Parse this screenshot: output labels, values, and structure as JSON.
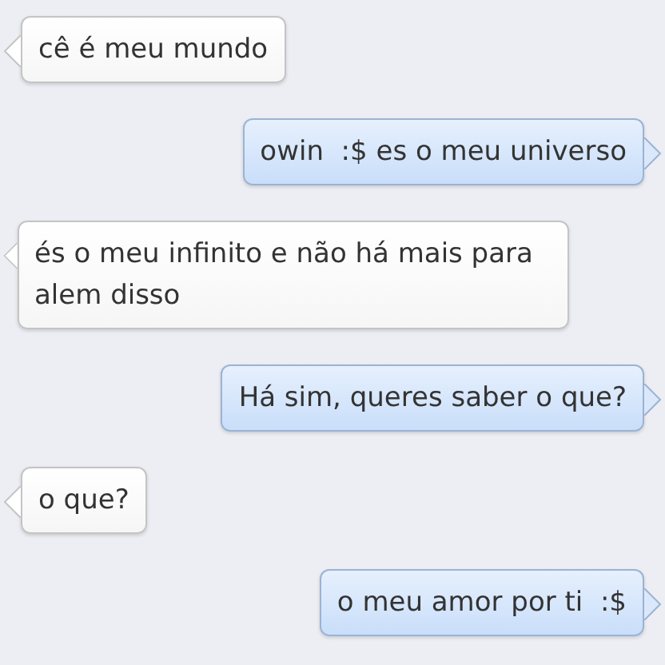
{
  "messages": [
    {
      "kind": "received",
      "text": "cê é meu mundo"
    },
    {
      "kind": "sent",
      "text": "owin  :$ es o meu universo"
    },
    {
      "kind": "received",
      "text": "és o meu infinito e não há mais para alem disso"
    },
    {
      "kind": "sent",
      "text": "Há sim, queres saber o que?"
    },
    {
      "kind": "received",
      "text": "o que?"
    },
    {
      "kind": "sent",
      "text": "o meu amor por ti  :$"
    }
  ]
}
